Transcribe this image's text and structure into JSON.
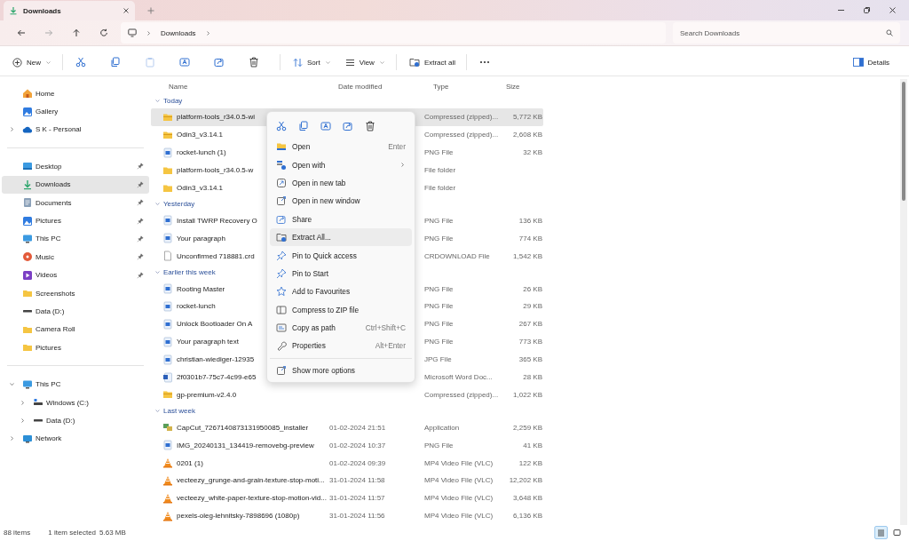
{
  "tab": {
    "title": "Downloads"
  },
  "address": {
    "crumbs": [
      "Downloads"
    ]
  },
  "search": {
    "placeholder": "Search Downloads"
  },
  "commands": [
    {
      "kind": "dropdown",
      "label": "New",
      "disabled": false
    },
    {
      "kind": "icon",
      "disabled": false
    },
    {
      "kind": "icon",
      "disabled": false
    },
    {
      "kind": "icon",
      "disabled": true
    },
    {
      "kind": "icon",
      "disabled": false
    },
    {
      "kind": "icon",
      "disabled": false
    },
    {
      "kind": "icon",
      "disabled": false
    },
    {
      "kind": "dropdown",
      "label": "Sort",
      "disabled": false
    },
    {
      "kind": "dropdown",
      "label": "View",
      "disabled": false
    },
    {
      "kind": "button",
      "label": "Extract all",
      "disabled": false
    },
    {
      "kind": "more",
      "disabled": false
    }
  ],
  "details_button": {
    "label": "Details"
  },
  "sidebar": {
    "sections": [
      {
        "items": [
          {
            "kind": "home",
            "label": "Home",
            "selected": false,
            "pinned": false
          },
          {
            "kind": "gallery",
            "label": "Gallery",
            "selected": false,
            "pinned": false
          },
          {
            "kind": "cloud",
            "label": "S K - Personal",
            "selected": false,
            "pinned": false,
            "expanded": false
          }
        ]
      },
      {
        "items": [
          {
            "kind": "desktop",
            "label": "Desktop",
            "selected": false,
            "pinned": true
          },
          {
            "kind": "download",
            "label": "Downloads",
            "selected": true,
            "pinned": true
          },
          {
            "kind": "documents",
            "label": "Documents",
            "selected": false,
            "pinned": true
          },
          {
            "kind": "pictures",
            "label": "Pictures",
            "selected": false,
            "pinned": true
          },
          {
            "kind": "pc",
            "label": "This PC",
            "selected": false,
            "pinned": true
          },
          {
            "kind": "music",
            "label": "Music",
            "selected": false,
            "pinned": true
          },
          {
            "kind": "videos",
            "label": "Videos",
            "selected": false,
            "pinned": true
          },
          {
            "kind": "folder",
            "label": "Screenshots",
            "selected": false,
            "pinned": false
          },
          {
            "kind": "drive",
            "label": "Data (D:)",
            "selected": false,
            "pinned": false
          },
          {
            "kind": "folder",
            "label": "Camera Roll",
            "selected": false,
            "pinned": false
          },
          {
            "kind": "folder",
            "label": "Pictures",
            "selected": false,
            "pinned": false
          }
        ]
      },
      {
        "items": [
          {
            "kind": "pc",
            "label": "This PC",
            "selected": false,
            "pinned": false,
            "expanded": true,
            "children": [
              {
                "kind": "windrive",
                "label": "Windows (C:)",
                "selected": false,
                "pinned": false,
                "expanded": false
              },
              {
                "kind": "drive",
                "label": "Data (D:)",
                "selected": false,
                "pinned": false,
                "expanded": false
              }
            ]
          },
          {
            "kind": "network",
            "label": "Network",
            "selected": false,
            "pinned": false,
            "expanded": false
          }
        ]
      }
    ]
  },
  "table": {
    "columns": [
      "Name",
      "Date modified",
      "Type",
      "Size"
    ],
    "groups": [
      {
        "label": "Today",
        "expanded": true,
        "rows": [
          {
            "kind": "zip",
            "name": "platform-tools_r34.0.5-wi",
            "type": "Compressed (zipped)...",
            "size": "5,772 KB",
            "selected": true
          },
          {
            "kind": "zip",
            "name": "Odin3_v3.14.1",
            "type": "Compressed (zipped)...",
            "size": "2,608 KB",
            "selected": false
          },
          {
            "kind": "image",
            "name": "rocket-lunch (1)",
            "type": "PNG File",
            "size": "32 KB",
            "selected": false
          },
          {
            "kind": "folder",
            "name": "platform-tools_r34.0.5-w",
            "type": "File folder",
            "selected": false
          },
          {
            "kind": "folder",
            "name": "Odin3_v3.14.1",
            "type": "File folder",
            "selected": false
          }
        ]
      },
      {
        "label": "Yesterday",
        "expanded": true,
        "rows": [
          {
            "kind": "image",
            "name": "Install TWRP Recovery O",
            "type": "PNG File",
            "size": "136 KB",
            "selected": false
          },
          {
            "kind": "image",
            "name": "Your paragraph",
            "type": "PNG File",
            "size": "774 KB",
            "selected": false
          },
          {
            "kind": "file",
            "name": "Unconfirmed 718881.crd",
            "type": "CRDOWNLOAD File",
            "size": "1,542 KB",
            "selected": false
          }
        ]
      },
      {
        "label": "Earlier this week",
        "expanded": true,
        "rows": [
          {
            "kind": "image",
            "name": "Rooting Master",
            "type": "PNG File",
            "size": "26 KB",
            "selected": false
          },
          {
            "kind": "image",
            "name": "rocket-lunch",
            "type": "PNG File",
            "size": "29 KB",
            "selected": false
          },
          {
            "kind": "image",
            "name": "Unlock Bootloader On A",
            "type": "PNG File",
            "size": "267 KB",
            "selected": false
          },
          {
            "kind": "image",
            "name": "Your paragraph text",
            "type": "PNG File",
            "size": "773 KB",
            "selected": false
          },
          {
            "kind": "image",
            "name": "christian-wiediger-12935",
            "type": "JPG File",
            "size": "365 KB",
            "selected": false
          },
          {
            "kind": "word",
            "name": "2f0301b7-75c7-4c99-e65",
            "type": "Microsoft Word Doc...",
            "size": "28 KB",
            "selected": false
          },
          {
            "kind": "zip",
            "name": "gp-premium-v2.4.0",
            "type": "Compressed (zipped)...",
            "size": "1,022 KB",
            "selected": false
          }
        ]
      },
      {
        "label": "Last week",
        "expanded": true,
        "rows": [
          {
            "kind": "app",
            "name": "CapCut_7267140873131950085_installer",
            "date": "01-02-2024 21:51",
            "type": "Application",
            "size": "2,259 KB",
            "selected": false
          },
          {
            "kind": "image",
            "name": "IMG_20240131_134419-removebg-preview",
            "date": "01-02-2024 10:37",
            "type": "PNG File",
            "size": "41 KB",
            "selected": false
          },
          {
            "kind": "video",
            "name": "0201 (1)",
            "date": "01-02-2024 09:39",
            "type": "MP4 Video File (VLC)",
            "size": "122 KB",
            "selected": false
          },
          {
            "kind": "video",
            "name": "vecteezy_grunge-and-grain-texture-stop-moti...",
            "date": "31-01-2024 11:58",
            "type": "MP4 Video File (VLC)",
            "size": "12,202 KB",
            "selected": false
          },
          {
            "kind": "video",
            "name": "vecteezy_white-paper-texture-stop-motion-vid...",
            "date": "31-01-2024 11:57",
            "type": "MP4 Video File (VLC)",
            "size": "3,648 KB",
            "selected": false
          },
          {
            "kind": "video",
            "name": "pexels-oleg-lehnitsky-7898696 (1080p)",
            "date": "31-01-2024 11:56",
            "type": "MP4 Video File (VLC)",
            "size": "6,136 KB",
            "selected": false
          }
        ]
      }
    ]
  },
  "context_menu": {
    "items": [
      {
        "kind": "item",
        "label": "Open",
        "shortcut": "Enter",
        "submenu": false,
        "highlighted": false
      },
      {
        "kind": "item",
        "label": "Open with",
        "submenu": true,
        "highlighted": false
      },
      {
        "kind": "item",
        "label": "Open in new tab",
        "submenu": false,
        "highlighted": false
      },
      {
        "kind": "item",
        "label": "Open in new window",
        "submenu": false,
        "highlighted": false
      },
      {
        "kind": "item",
        "label": "Share",
        "submenu": false,
        "highlighted": false
      },
      {
        "kind": "item",
        "label": "Extract All...",
        "submenu": false,
        "highlighted": true
      },
      {
        "kind": "item",
        "label": "Pin to Quick access",
        "submenu": false,
        "highlighted": false
      },
      {
        "kind": "item",
        "label": "Pin to Start",
        "submenu": false,
        "highlighted": false
      },
      {
        "kind": "item",
        "label": "Add to Favourites",
        "submenu": false,
        "highlighted": false
      },
      {
        "kind": "item",
        "label": "Compress to ZIP file",
        "submenu": false,
        "highlighted": false
      },
      {
        "kind": "item",
        "label": "Copy as path",
        "shortcut": "Ctrl+Shift+C",
        "submenu": false,
        "highlighted": false
      },
      {
        "kind": "item",
        "label": "Properties",
        "shortcut": "Alt+Enter",
        "submenu": false,
        "highlighted": false
      },
      {
        "kind": "separator"
      },
      {
        "kind": "item",
        "label": "Show more options",
        "submenu": false,
        "highlighted": false
      }
    ]
  },
  "status_bar": {
    "count": "88 items",
    "selection": "1 item selected",
    "selection_size": "5.63 MB",
    "views": [
      {
        "selected": true
      },
      {
        "selected": false
      }
    ]
  }
}
